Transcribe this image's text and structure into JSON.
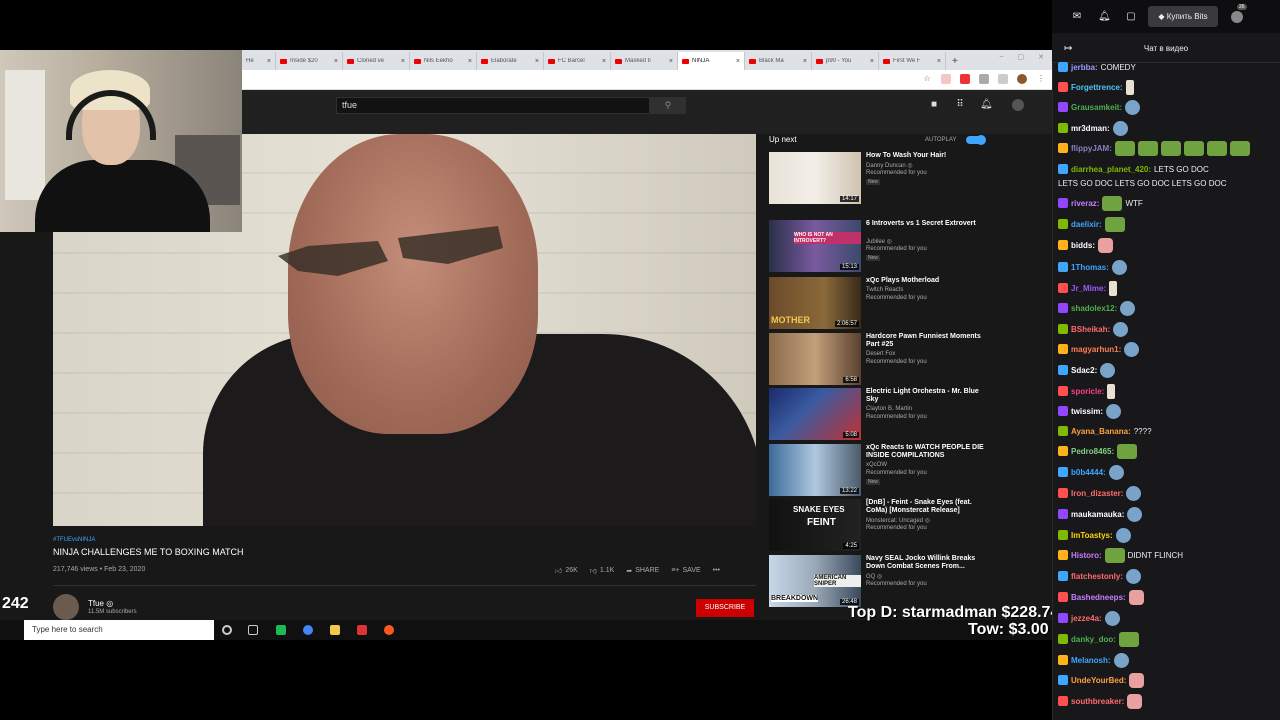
{
  "browser": {
    "tabs": [
      {
        "label": "He"
      },
      {
        "label": "Inside $20"
      },
      {
        "label": "Cloned ve"
      },
      {
        "label": "Nils Eekho"
      },
      {
        "label": "Elaborate"
      },
      {
        "label": "FC Barcel"
      },
      {
        "label": "Masked ti"
      },
      {
        "label": "NINJA",
        "active": true
      },
      {
        "label": "Black Ma"
      },
      {
        "label": "p90 - You"
      },
      {
        "label": "First We F"
      }
    ],
    "new_tab": "+"
  },
  "youtube": {
    "search_value": "tfue",
    "video": {
      "hashtag": "#TFUEvsNINJA",
      "title": "NINJA CHALLENGES ME TO BOXING MATCH",
      "views_date": "217,746 views • Feb 23, 2020",
      "likes": "26K",
      "dislikes": "1.1K",
      "share": "SHARE",
      "save": "SAVE",
      "more": "•••"
    },
    "channel": {
      "name": "Tfue ◎",
      "subs": "11.5M subscribers",
      "subscribe_label": "SUBSCRIBE"
    },
    "up_next": "Up next",
    "autoplay": "AUTOPLAY",
    "recommendations": [
      {
        "title": "How To Wash Your Hair!",
        "channel": "Danny Duncan ◎",
        "reason": "Recommended for you",
        "badge": "New",
        "duration": "14:17"
      },
      {
        "title": "6 Introverts vs 1 Secret Extrovert",
        "channel": "Jubilee ◎",
        "reason": "Recommended for you",
        "badge": "New",
        "duration": "15:13"
      },
      {
        "title": "xQc Plays Motherload",
        "channel": "Twitch Reacts",
        "reason": "Recommended for you",
        "badge": "",
        "duration": "2:06:57"
      },
      {
        "title": "Hardcore Pawn Funniest Moments Part #25",
        "channel": "Desert Fox",
        "reason": "Recommended for you",
        "badge": "",
        "duration": "6:58"
      },
      {
        "title": "Electric Light Orchestra - Mr. Blue Sky",
        "channel": "Clayton B. Martin",
        "reason": "Recommended for you",
        "badge": "",
        "duration": "5:08"
      },
      {
        "title": "xQc Reacts to WATCH PEOPLE DIE INSIDE COMPILATIONS",
        "channel": "xQcOW",
        "reason": "Recommended for you",
        "badge": "New",
        "duration": "13:22"
      },
      {
        "title": "[DnB] - Feint - Snake Eyes (feat. CoMa) [Monstercat Release]",
        "channel": "Monstercat: Uncaged ◎",
        "reason": "Recommended for you",
        "badge": "",
        "duration": "4:25"
      },
      {
        "title": "Navy SEAL Jocko Willink Breaks Down Combat Scenes From...",
        "channel": "GQ ◎",
        "reason": "Recommended for you",
        "badge": "",
        "duration": "26:48"
      }
    ],
    "thumb_texts": {
      "snake1": "SNAKE EYES",
      "snake2": "FEINT",
      "sniper": "AMERICAN SNIPER",
      "breakdown": "BREAKDOWN",
      "introvert": "WHO IS NOT AN INTROVERT?",
      "mother": "MOTHER"
    }
  },
  "stream_overlay": {
    "counter": "242",
    "donation_line1": "Top D: starmadman $228.74",
    "donation_line2": "Tow: $3.00"
  },
  "taskbar": {
    "search_placeholder": "Type here to search"
  },
  "twitch": {
    "bits_label": "Купить Bits",
    "notif_count": "26",
    "chat_title": "Чат в видео",
    "messages": [
      {
        "user": "jerbba:",
        "color": "#9b9bff",
        "text": "COMEDY",
        "emote": ""
      },
      {
        "user": "Forgettrence:",
        "color": "#4fc3f7",
        "text": "",
        "emote": "hand"
      },
      {
        "user": "Grausamkeit:",
        "color": "#4caf50",
        "text": "",
        "emote": "blue"
      },
      {
        "user": "mr3dman:",
        "color": "#ffffff",
        "text": "",
        "emote": "blue"
      },
      {
        "user": "flippyJAM:",
        "color": "#8e7cc3",
        "text": "",
        "emote": "frogs"
      },
      {
        "user": "diarrhea_planet_420:",
        "color": "#7fba00",
        "text": "LETS GO DOC",
        "emote": ""
      },
      {
        "user": "",
        "color": "#efeff1",
        "text": "LETS GO DOC    LETS GO DOC    LETS GO DOC",
        "emote": ""
      },
      {
        "user": "riveraz:",
        "color": "#c67dff",
        "text": "WTF",
        "emote": "frog"
      },
      {
        "user": "daelixir:",
        "color": "#3ea6ff",
        "text": "",
        "emote": "frog"
      },
      {
        "user": "bidds:",
        "color": "#ffffff",
        "text": "",
        "emote": "pink"
      },
      {
        "user": "1Thomas:",
        "color": "#3ea6ff",
        "text": "",
        "emote": "blue"
      },
      {
        "user": "Jr_Mime:",
        "color": "#9b59ff",
        "text": "",
        "emote": "hand"
      },
      {
        "user": "shadolex12:",
        "color": "#4caf50",
        "text": "",
        "emote": "blue"
      },
      {
        "user": "BSheikah:",
        "color": "#ff6b6b",
        "text": "",
        "emote": "blue"
      },
      {
        "user": "magyarhun1:",
        "color": "#ff7f50",
        "text": "",
        "emote": "blue"
      },
      {
        "user": "Sdac2:",
        "color": "#ffffff",
        "text": "",
        "emote": "blue"
      },
      {
        "user": "sporicle:",
        "color": "#ff3f7f",
        "text": "",
        "emote": "hand"
      },
      {
        "user": "twissim:",
        "color": "#ffffff",
        "text": "",
        "emote": "blue"
      },
      {
        "user": "Ayana_Banana:",
        "color": "#ff9f40",
        "text": "????",
        "emote": ""
      },
      {
        "user": "Pedro8465:",
        "color": "#7fd27f",
        "text": "",
        "emote": "frog"
      },
      {
        "user": "b0b4444:",
        "color": "#3ea6ff",
        "text": "",
        "emote": "blue"
      },
      {
        "user": "Iron_dizaster:",
        "color": "#ff6b6b",
        "text": "",
        "emote": "blue"
      },
      {
        "user": "maukamauka:",
        "color": "#ffffff",
        "text": "",
        "emote": "blue"
      },
      {
        "user": "ImToastys:",
        "color": "#ffd700",
        "text": "",
        "emote": "blue"
      },
      {
        "user": "Historo:",
        "color": "#c67dff",
        "text": "DIDNT FLINCH",
        "emote": "frog"
      },
      {
        "user": "flatchestonly:",
        "color": "#ff6b6b",
        "text": "",
        "emote": "blue"
      },
      {
        "user": "Bashedneeps:",
        "color": "#c67dff",
        "text": "",
        "emote": "pink"
      },
      {
        "user": "jezze4a:",
        "color": "#ff6b6b",
        "text": "",
        "emote": "blue"
      },
      {
        "user": "danky_doo:",
        "color": "#4caf50",
        "text": "",
        "emote": "frog"
      },
      {
        "user": "Melanosh:",
        "color": "#3ea6ff",
        "text": "",
        "emote": "blue"
      },
      {
        "user": "UndeYourBed:",
        "color": "#ff9f40",
        "text": "",
        "emote": "pink"
      },
      {
        "user": "southbreaker:",
        "color": "#ff6b6b",
        "text": "",
        "emote": "pink"
      }
    ]
  },
  "colors": {
    "yt_bg": "#181818",
    "yt_red": "#cc0000",
    "twitch_bg": "#18181b",
    "accent_blue": "#3ea6ff"
  }
}
